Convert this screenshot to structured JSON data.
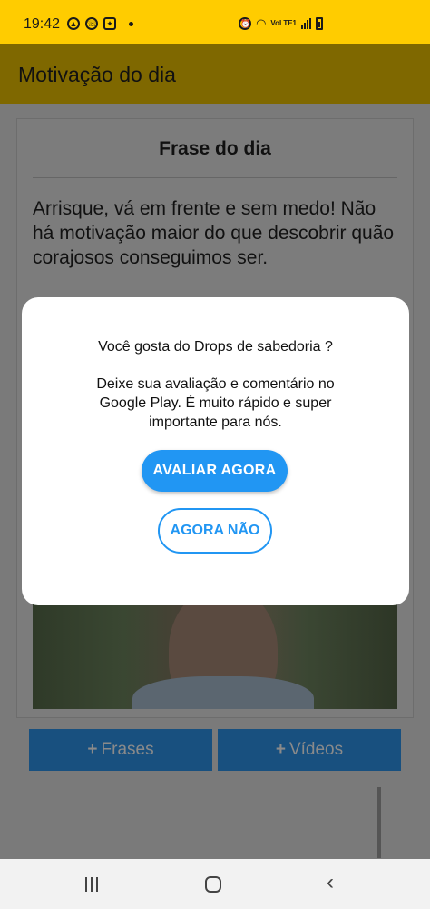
{
  "status_bar": {
    "time": "19:42",
    "network_label": "VoLTE1",
    "icons_left": [
      "navigation-app-icon",
      "whatsapp-icon",
      "game-icon",
      "notification-dot"
    ],
    "icons_right": [
      "alarm-icon",
      "wifi-icon",
      "volte-icon",
      "signal-icon",
      "battery-icon"
    ],
    "background_color": "#ffcc00"
  },
  "app_bar": {
    "title": "Motivação do dia"
  },
  "card": {
    "title": "Frase do dia",
    "quote": " Arrisque, vá em frente e sem medo! Não há motivação maior do que descobrir quão corajosos conseguimos ser."
  },
  "buttons": {
    "frases_label": "Frases",
    "videos_label": "Vídeos",
    "plus_symbol": "+",
    "color": "#1e6fb7"
  },
  "dialog": {
    "question": "Você gosta do Drops de sabedoria ?",
    "message": "Deixe sua avaliação e comentário no Google Play. É muito rápido e super importante para nós.",
    "rate_button": "AVALIAR AGORA",
    "later_button": "AGORA NÃO",
    "accent_color": "#2196f3"
  },
  "nav_bar": {
    "icons": [
      "recents-icon",
      "home-icon",
      "back-icon"
    ]
  }
}
